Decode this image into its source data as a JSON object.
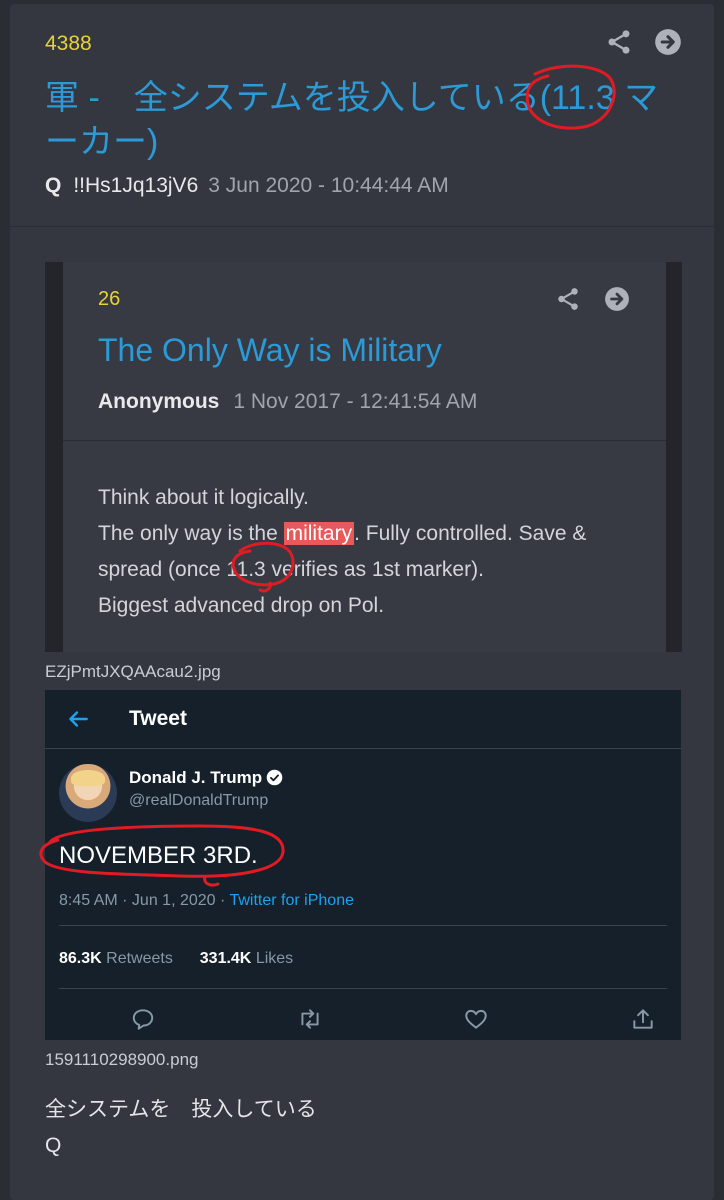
{
  "post": {
    "number": "4388",
    "title": "軍 -　全システムを投入している(11.3 マーカー)",
    "author": "Q",
    "tripcode": "!!Hs1Jq13jV6",
    "date": "3 Jun 2020 - 10:44:44 AM"
  },
  "quoted": {
    "number": "26",
    "title": "The Only Way is Military",
    "author": "Anonymous",
    "date": "1 Nov 2017 - 12:41:54 AM",
    "body": {
      "line1": "Think about it logically.",
      "line2_pre": "The only way is the ",
      "line2_hl": "military",
      "line2_post": ". Fully controlled. Save &",
      "line3": "spread (once 11.3 verifies as 1st marker).",
      "line4": "Biggest advanced drop on Pol."
    }
  },
  "attachments": {
    "file1": "EZjPmtJXQAAcau2.jpg",
    "file2": "1591110298900.png"
  },
  "tweet": {
    "header": "Tweet",
    "name": "Donald J. Trump",
    "handle": "@realDonaldTrump",
    "text": "NOVEMBER 3RD.",
    "time": "8:45 AM · Jun 1, 2020 · ",
    "source": "Twitter for iPhone",
    "retweets_count": "86.3K",
    "retweets_label": "Retweets",
    "likes_count": "331.4K",
    "likes_label": "Likes"
  },
  "footer": {
    "line1": "全システムを　投入している",
    "line2": "Q"
  },
  "colors": {
    "accent": "#2b9ad6",
    "post_number": "#e6d23a",
    "highlight": "#e85a5a",
    "annotation": "#e01b24",
    "tweet_bg": "#15202b"
  },
  "icons": [
    "share-icon",
    "arrow-right-circle-icon",
    "back-arrow-icon",
    "verified-badge-icon",
    "reply-icon",
    "retweet-icon",
    "like-icon",
    "upload-icon"
  ]
}
